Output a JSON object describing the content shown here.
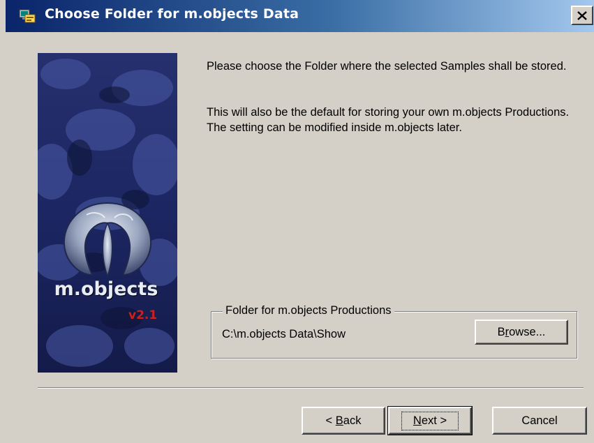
{
  "window": {
    "title": "Choose Folder for m.objects Data",
    "close_symbol": "×"
  },
  "side_image": {
    "logo_text": "m.objects",
    "version_text": "v2.1",
    "accent_color": "#cc2020"
  },
  "message": {
    "line1": "Please choose the Folder where the selected Samples shall be stored.",
    "line2": "This will also be the default for storing your own m.objects Productions. The setting can be modified inside m.objects later."
  },
  "folder_group": {
    "legend": "Folder for m.objects Productions",
    "path": "C:\\m.objects Data\\Show",
    "browse": {
      "pre": "B",
      "underline": "r",
      "post": "owse..."
    }
  },
  "buttons": {
    "back": {
      "pre": "< ",
      "underline": "B",
      "post": "ack"
    },
    "next": {
      "pre": "",
      "underline": "N",
      "post": "ext >"
    },
    "cancel": "Cancel"
  },
  "colors": {
    "title_bar_start": "#0a246a",
    "title_bar_end": "#a6caf0",
    "dialog_face": "#d4d0c8"
  },
  "icons": {
    "title": "setup-wizard-icon",
    "close": "close-icon"
  }
}
